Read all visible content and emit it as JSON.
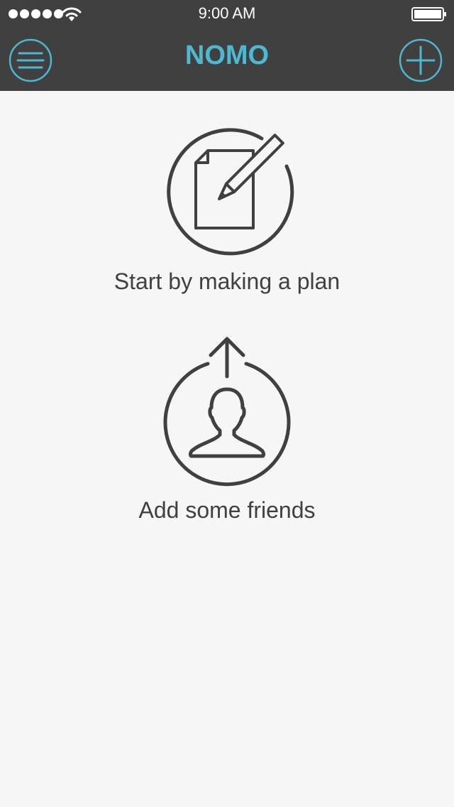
{
  "status_bar": {
    "time": "9:00 AM",
    "signal_icon": "signal-dots-icon",
    "wifi_icon": "wifi-icon",
    "battery_icon": "battery-icon"
  },
  "nav": {
    "title": "NOMO",
    "menu_icon": "hamburger-menu-icon",
    "add_icon": "plus-icon"
  },
  "colors": {
    "accent": "#4db8cf",
    "nav_background": "#404040",
    "page_background": "#f6f6f6",
    "icon_stroke": "#404040"
  },
  "actions": {
    "plan": {
      "label": "Start by making a plan",
      "icon": "document-pencil-icon"
    },
    "friends": {
      "label": "Add some friends",
      "icon": "person-upload-icon"
    }
  }
}
